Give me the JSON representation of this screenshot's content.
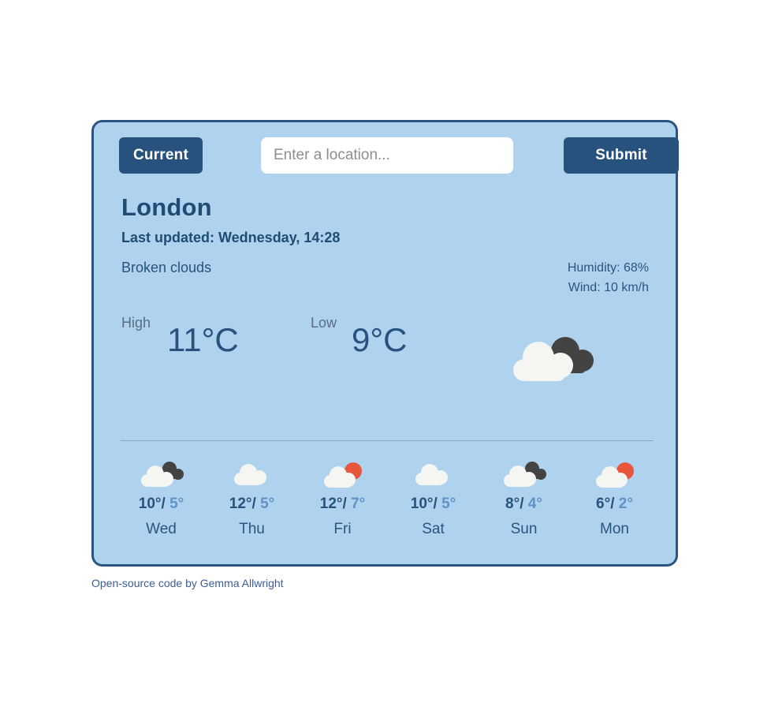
{
  "app": {
    "card_background": "#AFD3EF",
    "accent_navy": "#27527E",
    "accent_orange": "#E8563C"
  },
  "header": {
    "current_label": "Current",
    "submit_label": "Submit",
    "search_placeholder": "Enter a location...",
    "search_value": ""
  },
  "current": {
    "city": "London",
    "last_updated": "Last updated: Wednesday, 14:28",
    "conditions": "Broken clouds",
    "humidity": "Humidity: 68%",
    "wind": "Wind: 10 km/h",
    "high_label": "High",
    "high_value": "11°C",
    "low_label": "Low",
    "low_value": "9°C",
    "icon": "broken-clouds-icon"
  },
  "forecast": [
    {
      "day": "Wed",
      "high": "10°/",
      "low": "5°",
      "icon": "broken-clouds-icon"
    },
    {
      "day": "Thu",
      "high": "12°/",
      "low": "5°",
      "icon": "cloud-icon"
    },
    {
      "day": "Fri",
      "high": "12°/",
      "low": "7°",
      "icon": "sun-cloud-icon"
    },
    {
      "day": "Sat",
      "high": "10°/",
      "low": "5°",
      "icon": "cloud-icon"
    },
    {
      "day": "Sun",
      "high": "8°/",
      "low": "4°",
      "icon": "broken-clouds-icon"
    },
    {
      "day": "Mon",
      "high": "6°/",
      "low": "2°",
      "icon": "sun-cloud-icon"
    }
  ],
  "footer": {
    "credit": "Open-source code by Gemma Allwright"
  }
}
